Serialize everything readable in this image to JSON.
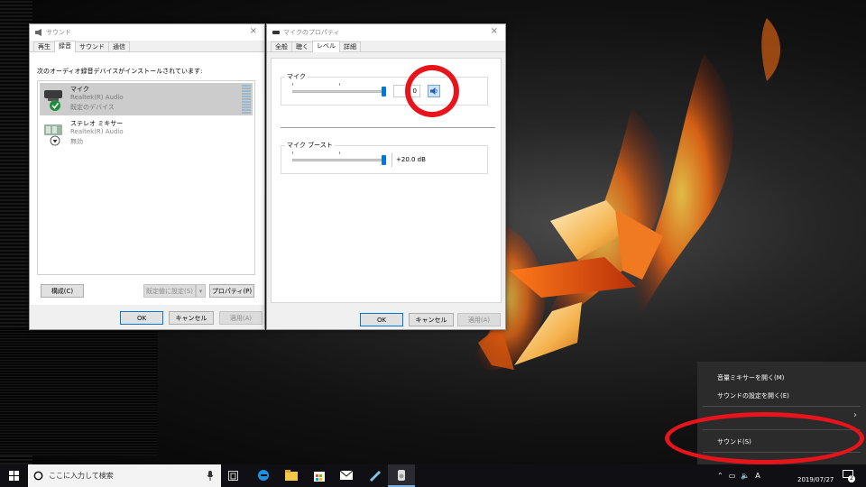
{
  "sound_window": {
    "title": "サウンド",
    "tabs": [
      "再生",
      "録音",
      "サウンド",
      "通信"
    ],
    "active_tab": 1,
    "instruction": "次のオーディオ録音デバイスがインストールされています:",
    "devices": [
      {
        "name": "マイク",
        "driver": "Realtek(R) Audio",
        "status": "既定のデバイス",
        "selected": true
      },
      {
        "name": "ステレオ ミキサー",
        "driver": "Realtek(R) Audio",
        "status": "無効",
        "selected": false
      }
    ],
    "configure_label": "構成(C)",
    "set_default_label": "既定値に設定(S)",
    "properties_label": "プロパティ(P)",
    "ok_label": "OK",
    "cancel_label": "キャンセル",
    "apply_label": "適用(A)"
  },
  "mic_props": {
    "title": "マイクのプロパティ",
    "tabs": [
      "全般",
      "聴く",
      "レベル",
      "詳細"
    ],
    "active_tab": 2,
    "mic_group_label": "マイク",
    "mic_level_value": "0",
    "mic_level": 1.0,
    "boost_group_label": "マイク ブースト",
    "boost_value": "+20.0 dB",
    "boost_level": 1.0,
    "ok_label": "OK",
    "cancel_label": "キャンセル",
    "apply_label": "適用(A)"
  },
  "context_menu": {
    "items": [
      "音量ミキサーを開く(M)",
      "サウンドの設定を開く(E)",
      "サウンド(S)"
    ]
  },
  "taskbar": {
    "search_placeholder": "ここに入力して検索",
    "ime_indicator": "A",
    "date": "2019/07/27",
    "notification_count": "2"
  },
  "colors": {
    "accent": "#0078d7",
    "highlight_circle": "#e8141c",
    "taskbar": "#0f0f14"
  }
}
